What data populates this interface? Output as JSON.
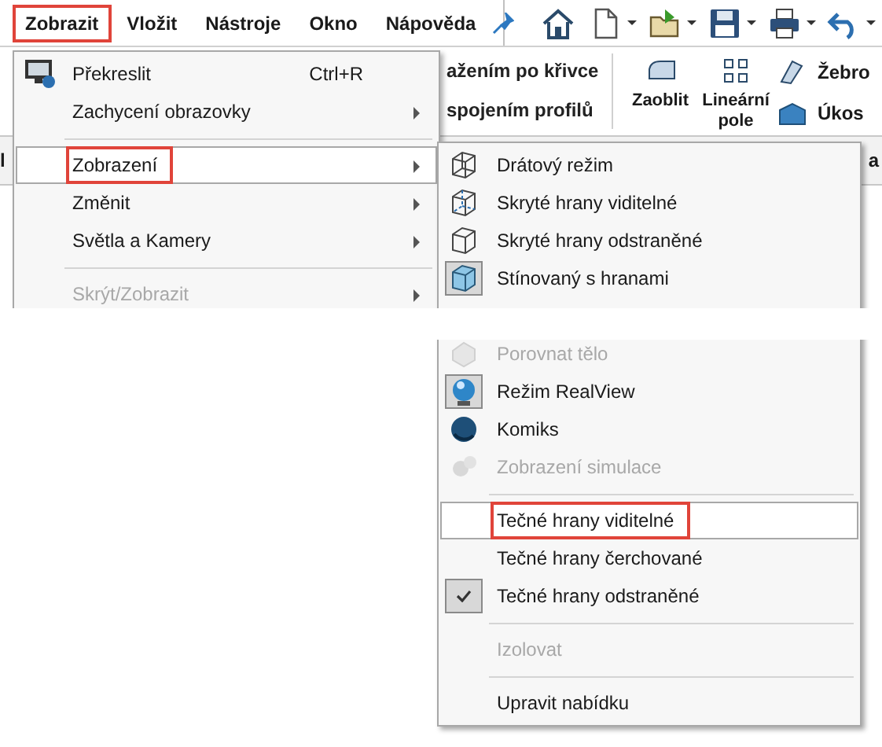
{
  "menubar": {
    "items": [
      {
        "label": "Zobrazit",
        "annotated": true
      },
      {
        "label": "Vložit",
        "annotated": false
      },
      {
        "label": "Nástroje",
        "annotated": false
      },
      {
        "label": "Okno",
        "annotated": false
      },
      {
        "label": "Nápověda",
        "annotated": false
      }
    ]
  },
  "toolbar": {
    "buttons": [
      {
        "kind": "home",
        "dropdown": false
      },
      {
        "kind": "new",
        "dropdown": true
      },
      {
        "kind": "open",
        "dropdown": true
      },
      {
        "kind": "save",
        "dropdown": true
      },
      {
        "kind": "print",
        "dropdown": true
      },
      {
        "kind": "undo",
        "dropdown": true
      }
    ]
  },
  "ribbon": {
    "left_items": [
      "ažením po křivce",
      "spojením profilů"
    ],
    "large_tools": [
      {
        "kind": "fillet",
        "label": "Zaoblit"
      },
      {
        "kind": "pattern",
        "label": "Lineární pole"
      }
    ],
    "small_tools": [
      {
        "kind": "rib",
        "label": "Žebro"
      },
      {
        "kind": "draft",
        "label": "Úkos"
      }
    ]
  },
  "tab_strip": {
    "left": "l",
    "right": "a"
  },
  "menu": {
    "items": [
      {
        "kind": "item",
        "label": "Překreslit",
        "shortcut": "Ctrl+R",
        "submenu": false,
        "selected": false,
        "disabled": false,
        "annotated": false
      },
      {
        "kind": "item",
        "label": "Zachycení obrazovky",
        "submenu": true,
        "selected": false,
        "disabled": false,
        "annotated": false
      },
      {
        "kind": "separator"
      },
      {
        "kind": "item",
        "label": "Zobrazení",
        "submenu": true,
        "selected": true,
        "disabled": false,
        "annotated": true
      },
      {
        "kind": "item",
        "label": "Změnit",
        "submenu": true,
        "selected": false,
        "disabled": false,
        "annotated": false
      },
      {
        "kind": "item",
        "label": "Světla a Kamery",
        "submenu": true,
        "selected": false,
        "disabled": false,
        "annotated": false
      },
      {
        "kind": "separator"
      },
      {
        "kind": "item",
        "label": "Skrýt/Zobrazit",
        "submenu": true,
        "selected": false,
        "disabled": true,
        "annotated": false
      }
    ]
  },
  "submenu": {
    "items": [
      {
        "kind": "item",
        "label": "Drátový režim",
        "selected": false,
        "disabled": false,
        "checked": false,
        "annotated": false
      },
      {
        "kind": "item",
        "label": "Skryté hrany viditelné",
        "selected": false,
        "disabled": false,
        "checked": false,
        "annotated": false
      },
      {
        "kind": "item",
        "label": "Skryté hrany odstraněné",
        "selected": false,
        "disabled": false,
        "checked": false,
        "annotated": false
      },
      {
        "kind": "item",
        "label": "Stínovaný s hranami",
        "selected": false,
        "disabled": false,
        "checked": true,
        "annotated": false
      },
      {
        "kind": "blank"
      },
      {
        "kind": "item",
        "label": "Porovnat tělo",
        "selected": false,
        "disabled": true,
        "checked": false,
        "annotated": false
      },
      {
        "kind": "item",
        "label": "Režim RealView",
        "selected": false,
        "disabled": false,
        "checked": true,
        "annotated": false
      },
      {
        "kind": "item",
        "label": "Komiks",
        "selected": false,
        "disabled": false,
        "checked": false,
        "annotated": false
      },
      {
        "kind": "item",
        "label": "Zobrazení simulace",
        "selected": false,
        "disabled": true,
        "checked": false,
        "annotated": false
      },
      {
        "kind": "separator"
      },
      {
        "kind": "item",
        "label": "Tečné hrany viditelné",
        "selected": true,
        "disabled": false,
        "checked": false,
        "annotated": true
      },
      {
        "kind": "item",
        "label": "Tečné hrany čerchované",
        "selected": false,
        "disabled": false,
        "checked": false,
        "annotated": false
      },
      {
        "kind": "item",
        "label": "Tečné hrany odstraněné",
        "selected": false,
        "disabled": false,
        "checked": true,
        "annotated": false
      },
      {
        "kind": "separator"
      },
      {
        "kind": "item",
        "label": "Izolovat",
        "selected": false,
        "disabled": true,
        "checked": false,
        "annotated": false
      },
      {
        "kind": "separator"
      },
      {
        "kind": "item",
        "label": "Upravit nabídku",
        "selected": false,
        "disabled": false,
        "checked": false,
        "annotated": false
      }
    ]
  }
}
